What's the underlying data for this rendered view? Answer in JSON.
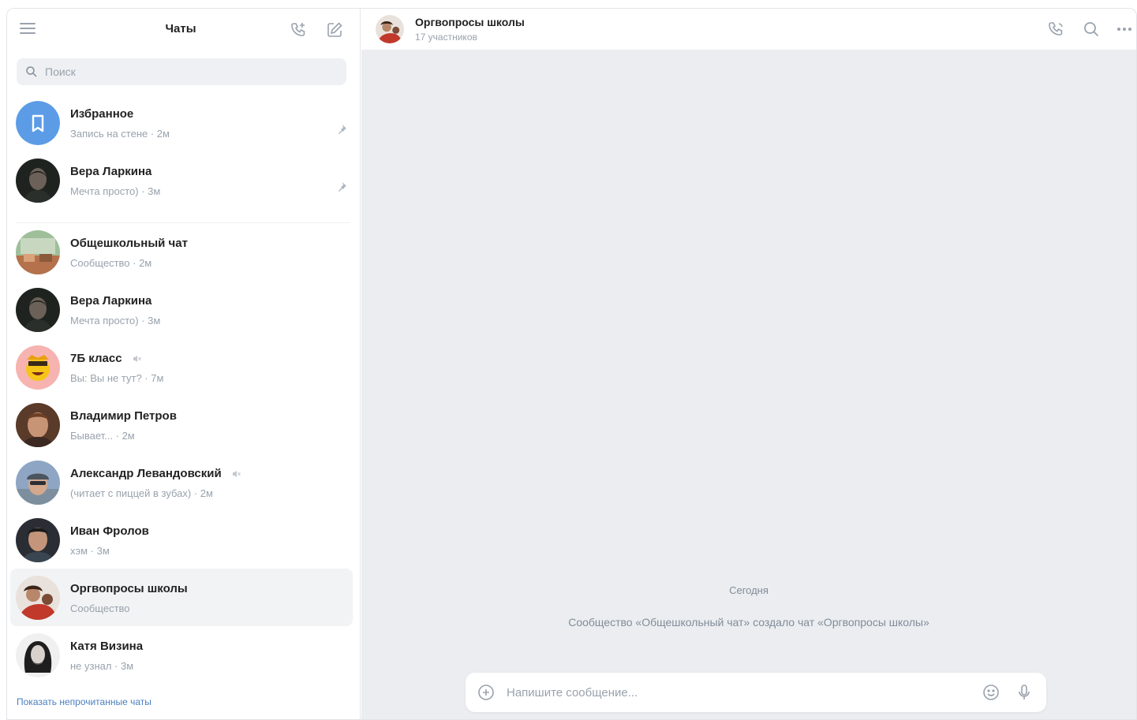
{
  "sidebar": {
    "title": "Чаты",
    "search_placeholder": "Поиск",
    "pinned": [
      {
        "name": "Избранное",
        "preview": "Запись на стене · 2м",
        "pinned": true,
        "avatar": "bookmark-avatar"
      },
      {
        "name": "Вера Ларкина",
        "preview": "Мечта просто) · 3м",
        "pinned": true,
        "avatar": "woman-portrait"
      }
    ],
    "chats": [
      {
        "name": "Общешкольный чат",
        "preview": "Сообщество · 2м",
        "avatar": "classroom-photo"
      },
      {
        "name": "Вера Ларкина",
        "preview": "Мечта просто) · 3м",
        "avatar": "woman-portrait"
      },
      {
        "name": "7Б класс",
        "preview": "Вы: Вы не тут? · 7м",
        "muted": true,
        "avatar": "emoji-face"
      },
      {
        "name": "Владимир Петров",
        "preview": "Бывает... · 2м",
        "avatar": "man-portrait"
      },
      {
        "name": "Александр Левандовский",
        "preview": "(читает с пиццей в зубах) · 2м",
        "muted": true,
        "avatar": "man-cap-portrait"
      },
      {
        "name": "Иван Фролов",
        "preview": "хэм · 3м",
        "avatar": "man-portrait-2"
      },
      {
        "name": "Оргвопросы школы",
        "preview": "Сообщество",
        "selected": true,
        "avatar": "group-photo"
      },
      {
        "name": "Катя Визина",
        "preview": "не узнал · 3м",
        "avatar": "woman-bw-portrait"
      }
    ],
    "show_unread_link": "Показать непрочитанные чаты"
  },
  "main": {
    "title": "Оргвопросы школы",
    "subtitle": "17 участников",
    "date_divider": "Сегодня",
    "service_message": "Сообщество «Общешкольный чат» создало чат «Оргвопросы школы»",
    "composer_placeholder": "Напишите сообщение..."
  },
  "colors": {
    "accent": "#4a7fc0",
    "chat_background": "#ebedf0",
    "muted_text": "#99a2ad",
    "selected_row": "#f2f3f5"
  }
}
